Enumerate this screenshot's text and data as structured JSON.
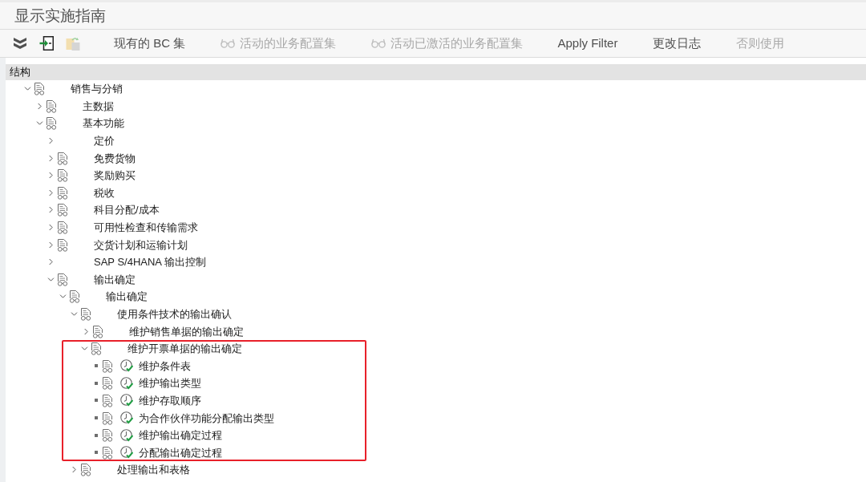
{
  "window": {
    "title": "显示实施指南"
  },
  "toolbar": {
    "icon_buttons": [
      {
        "kind": "collapse",
        "disabled": false
      },
      {
        "kind": "import",
        "disabled": false
      },
      {
        "kind": "paste",
        "disabled": true
      }
    ],
    "buttons": [
      {
        "label": "现有的 BC 集",
        "kind": "plain",
        "disabled": false
      },
      {
        "label": "活动的业务配置集",
        "kind": "glasses",
        "disabled": true
      },
      {
        "label": "活动已激活的业务配置集",
        "kind": "glasses",
        "disabled": true
      },
      {
        "label": "Apply Filter",
        "kind": "plain",
        "disabled": false
      },
      {
        "label": "更改日志",
        "kind": "plain",
        "disabled": false
      },
      {
        "label": "否则使用",
        "kind": "plain",
        "disabled": true
      }
    ]
  },
  "tree": {
    "header": "结构",
    "nodes": [
      {
        "label": "销售与分销",
        "kind": "folder",
        "doc_icon": true,
        "expanded": true,
        "highlighted": false,
        "children": [
          {
            "label": "主数据",
            "kind": "folder",
            "doc_icon": true,
            "expanded": false,
            "highlighted": false
          },
          {
            "label": "基本功能",
            "kind": "folder",
            "doc_icon": true,
            "expanded": true,
            "highlighted": false,
            "children": [
              {
                "label": "定价",
                "kind": "folder",
                "doc_icon": false,
                "expanded": false,
                "highlighted": false
              },
              {
                "label": "免费货物",
                "kind": "folder",
                "doc_icon": true,
                "expanded": false,
                "highlighted": false
              },
              {
                "label": "奖励购买",
                "kind": "folder",
                "doc_icon": true,
                "expanded": false,
                "highlighted": false
              },
              {
                "label": "税收",
                "kind": "folder",
                "doc_icon": true,
                "expanded": false,
                "highlighted": false
              },
              {
                "label": "科目分配/成本",
                "kind": "folder",
                "doc_icon": true,
                "expanded": false,
                "highlighted": false
              },
              {
                "label": "可用性检查和传输需求",
                "kind": "folder",
                "doc_icon": true,
                "expanded": false,
                "highlighted": false
              },
              {
                "label": "交货计划和运输计划",
                "kind": "folder",
                "doc_icon": true,
                "expanded": false,
                "highlighted": false
              },
              {
                "label": "SAP S/4HANA 输出控制",
                "kind": "folder",
                "doc_icon": false,
                "expanded": false,
                "highlighted": false
              },
              {
                "label": "输出确定",
                "kind": "folder",
                "doc_icon": true,
                "expanded": true,
                "highlighted": false,
                "children": [
                  {
                    "label": "输出确定",
                    "kind": "folder",
                    "doc_icon": true,
                    "expanded": true,
                    "highlighted": false,
                    "children": [
                      {
                        "label": "使用条件技术的输出确认",
                        "kind": "folder",
                        "doc_icon": true,
                        "expanded": true,
                        "highlighted": false,
                        "children": [
                          {
                            "label": "维护销售单据的输出确定",
                            "kind": "folder",
                            "doc_icon": true,
                            "expanded": false,
                            "highlighted": false
                          },
                          {
                            "label": "维护开票单据的输出确定",
                            "kind": "folder",
                            "doc_icon": true,
                            "expanded": true,
                            "highlighted": true,
                            "children": [
                              {
                                "label": "维护条件表",
                                "kind": "activity",
                                "doc_icon": true,
                                "highlighted": false
                              },
                              {
                                "label": "维护输出类型",
                                "kind": "activity",
                                "doc_icon": true,
                                "highlighted": false
                              },
                              {
                                "label": "维护存取顺序",
                                "kind": "activity",
                                "doc_icon": true,
                                "highlighted": false
                              },
                              {
                                "label": "为合作伙伴功能分配输出类型",
                                "kind": "activity",
                                "doc_icon": true,
                                "highlighted": false
                              },
                              {
                                "label": "维护输出确定过程",
                                "kind": "activity",
                                "doc_icon": true,
                                "highlighted": false
                              },
                              {
                                "label": "分配输出确定过程",
                                "kind": "activity",
                                "doc_icon": true,
                                "highlighted": false
                              }
                            ]
                          }
                        ]
                      },
                      {
                        "label": "处理输出和表格",
                        "kind": "folder",
                        "doc_icon": true,
                        "expanded": false,
                        "highlighted": false
                      }
                    ]
                  }
                ]
              }
            ]
          }
        ]
      }
    ]
  }
}
